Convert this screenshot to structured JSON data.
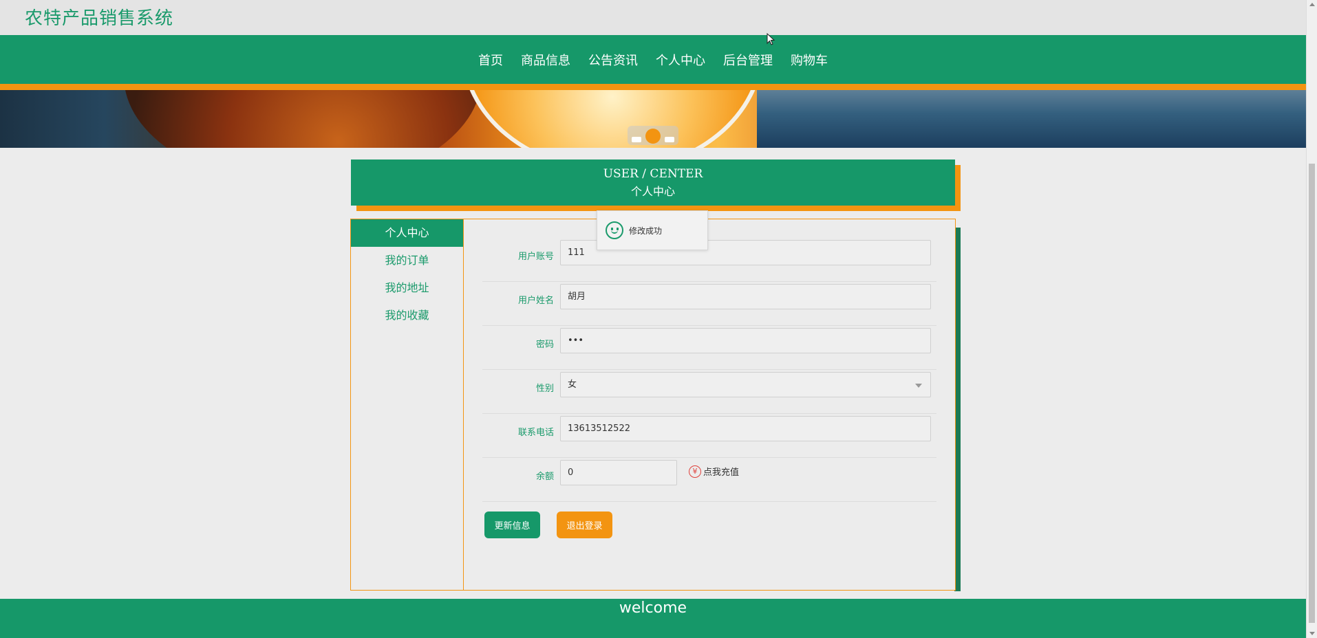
{
  "site": {
    "title": "农特产品销售系统"
  },
  "nav": {
    "items": [
      {
        "label": "首页"
      },
      {
        "label": "商品信息"
      },
      {
        "label": "公告资讯"
      },
      {
        "label": "个人中心"
      },
      {
        "label": "后台管理"
      },
      {
        "label": "购物车"
      }
    ]
  },
  "center": {
    "title_en": "USER / CENTER",
    "title_cn": "个人中心"
  },
  "sidebar": {
    "items": [
      {
        "label": "个人中心",
        "active": true
      },
      {
        "label": "我的订单"
      },
      {
        "label": "我的地址"
      },
      {
        "label": "我的收藏"
      }
    ]
  },
  "form": {
    "account": {
      "label": "用户账号",
      "value": "111"
    },
    "name": {
      "label": "用户姓名",
      "value": "胡月"
    },
    "password": {
      "label": "密码",
      "value": "•••"
    },
    "gender": {
      "label": "性别",
      "value": "女"
    },
    "phone": {
      "label": "联系电话",
      "value": "13613512522"
    },
    "balance": {
      "label": "余额",
      "value": "0",
      "recharge_label": "点我充值"
    },
    "update_button": "更新信息",
    "logout_button": "退出登录"
  },
  "toast": {
    "message": "修改成功"
  },
  "footer": {
    "text": "welcome"
  },
  "colors": {
    "primary": "#169869",
    "accent": "#f39411"
  },
  "slider": {
    "active_index": 1,
    "count": 3
  }
}
